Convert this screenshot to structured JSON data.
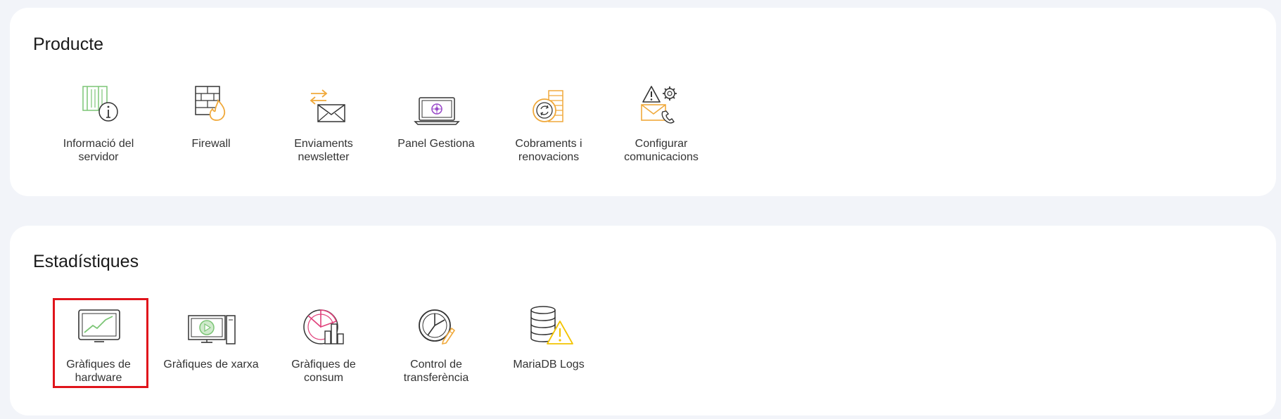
{
  "colors": {
    "green": "#7cc576",
    "orange": "#f0a93b",
    "purple": "#9b4dca",
    "pink": "#e0407a",
    "yellow": "#f3c400",
    "dark": "#333333",
    "selection": "#e0141b"
  },
  "product": {
    "title": "Producte",
    "items": [
      {
        "label": "Informació del servidor",
        "icon": "server-info-icon"
      },
      {
        "label": "Firewall",
        "icon": "firewall-icon"
      },
      {
        "label": "Enviaments newsletter",
        "icon": "newsletter-icon"
      },
      {
        "label": "Panel Gestiona",
        "icon": "panel-gestiona-icon"
      },
      {
        "label": "Cobraments i renovacions",
        "icon": "billing-icon"
      },
      {
        "label": "Configurar comunicacions",
        "icon": "communications-icon"
      }
    ]
  },
  "stats": {
    "title": "Estadístiques",
    "items": [
      {
        "label": "Gràfiques de hardware",
        "icon": "hardware-chart-icon",
        "selected": true
      },
      {
        "label": "Gràfiques de xarxa",
        "icon": "network-chart-icon"
      },
      {
        "label": "Gràfiques de consum",
        "icon": "consumption-chart-icon"
      },
      {
        "label": "Control de transferència",
        "icon": "transfer-control-icon"
      },
      {
        "label": "MariaDB Logs",
        "icon": "mariadb-logs-icon"
      }
    ]
  }
}
